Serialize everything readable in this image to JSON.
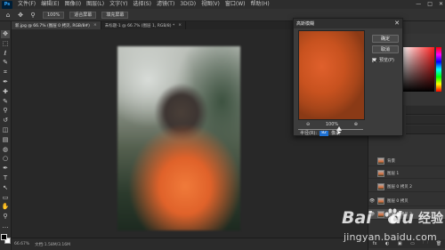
{
  "app": {
    "logo_text": "Ps"
  },
  "menu": [
    "文件(F)",
    "编辑(E)",
    "图像(I)",
    "图层(L)",
    "文字(Y)",
    "选择(S)",
    "滤镜(T)",
    "3D(D)",
    "视图(V)",
    "窗口(W)",
    "帮助(H)"
  ],
  "window_controls": {
    "minimize": "—",
    "maximize": "□",
    "close": "✕"
  },
  "options_bar": {
    "tool_icon": "move-icon",
    "zoom_value": "100%",
    "fit_screen_label": "适合屏幕",
    "fill_screen_label": "填充屏幕"
  },
  "tabs": [
    {
      "label": "新.jpg @ 66.7% (图层 0 拷贝, RGB/8#)",
      "close": "×"
    },
    {
      "label": "未标题-1 @ 66.7% (图层 1, RGB/8) *",
      "close": "×"
    }
  ],
  "tools": [
    "move-icon",
    "marquee-icon",
    "lasso-icon",
    "quick-select-icon",
    "crop-icon",
    "eyedropper-icon",
    "healing-icon",
    "brush-icon",
    "stamp-icon",
    "history-brush-icon",
    "eraser-icon",
    "gradient-icon",
    "blur-icon",
    "dodge-icon",
    "pen-icon",
    "type-icon",
    "path-select-icon",
    "shape-icon",
    "hand-icon",
    "zoom-icon",
    "more-icon"
  ],
  "tool_glyphs": [
    "✥",
    "⬚",
    "ℓ",
    "✎",
    "⌗",
    "✒",
    "✚",
    "✎",
    "⚲",
    "↺",
    "◫",
    "▤",
    "◍",
    "○",
    "✒",
    "T",
    "↖",
    "▭",
    "✋",
    "⚲",
    "…"
  ],
  "status_bar": {
    "zoom": "66.67%",
    "doc_info": "文档:1.58M/3.16M"
  },
  "dialog": {
    "title": "高斯模糊",
    "close": "✕",
    "ok_label": "确定",
    "cancel_label": "取消",
    "preview_label": "预览(P)",
    "preview_checked": true,
    "zoom_out": "⊖",
    "zoom_level": "100%",
    "zoom_in": "⊕",
    "radius_label": "半径(R):",
    "radius_value": "82",
    "radius_unit": "像素"
  },
  "layers": [
    {
      "name": "背景",
      "visible": false
    },
    {
      "name": "图层 1",
      "visible": false
    },
    {
      "name": "图层 0 拷贝 2",
      "visible": false
    },
    {
      "name": "图层 0 拷贝",
      "visible": true
    },
    {
      "name": "图层 0 拷贝 3",
      "visible": true
    }
  ],
  "layer_footer_icons": [
    "fx",
    "◐",
    "▣",
    "▭",
    "🗀",
    "🗑"
  ],
  "watermark": {
    "brand_left": "Bai",
    "brand_right": "du",
    "brand_cn": "经验",
    "url": "jingyan.baidu.com"
  }
}
